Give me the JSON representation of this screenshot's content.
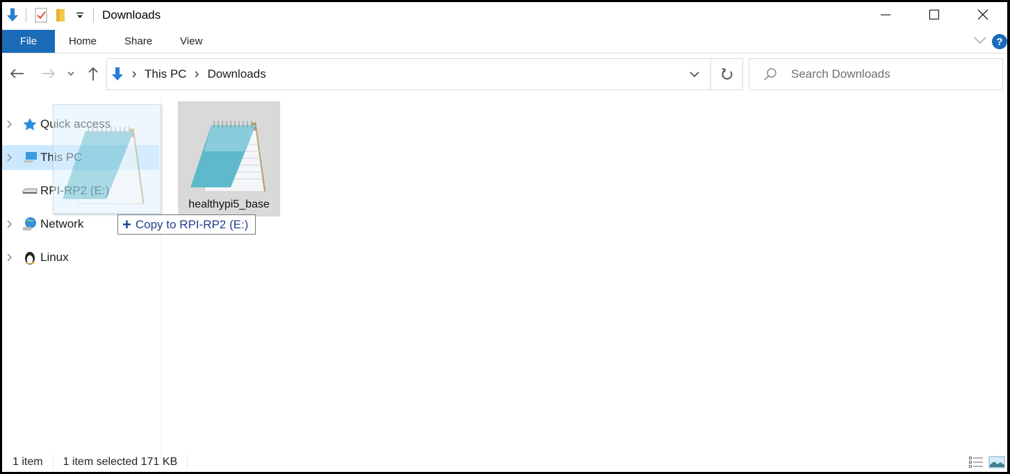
{
  "window": {
    "title": "Downloads",
    "controls": {
      "minimize": "minimize",
      "maximize": "maximize",
      "close": "close"
    }
  },
  "quick_access_toolbar": {
    "icons": [
      "download-arrow-icon",
      "properties-checklist-icon",
      "new-folder-icon",
      "customize-dropdown-icon"
    ]
  },
  "ribbon": {
    "tabs": [
      {
        "label": "File",
        "active": true
      },
      {
        "label": "Home"
      },
      {
        "label": "Share"
      },
      {
        "label": "View"
      }
    ],
    "help_label": "?"
  },
  "navigation": {
    "breadcrumb": [
      "This PC",
      "Downloads"
    ],
    "search_placeholder": "Search Downloads"
  },
  "nav_pane": {
    "items": [
      {
        "label": "Quick access",
        "icon": "star-icon",
        "expandable": true
      },
      {
        "label": "This PC",
        "icon": "computer-icon",
        "expandable": true,
        "selected": true
      },
      {
        "label": "RPI-RP2 (E:)",
        "icon": "drive-icon",
        "expandable": false
      },
      {
        "label": "Network",
        "icon": "network-icon",
        "expandable": true
      },
      {
        "label": "Linux",
        "icon": "linux-penguin-icon",
        "expandable": true
      }
    ]
  },
  "content": {
    "files": [
      {
        "name": "healthypi5_base",
        "icon": "notepad-file-icon",
        "selected": true
      }
    ]
  },
  "drag": {
    "tooltip": "Copy to RPI-RP2 (E:)",
    "tooltip_icon": "+"
  },
  "status_bar": {
    "item_count": "1 item",
    "selection": "1 item selected  171 KB"
  },
  "colors": {
    "accent": "#1a6bb8",
    "selection": "#cce8ff",
    "selected_tile": "#d9d9d9",
    "tooltip_text": "#1f3f8f"
  }
}
